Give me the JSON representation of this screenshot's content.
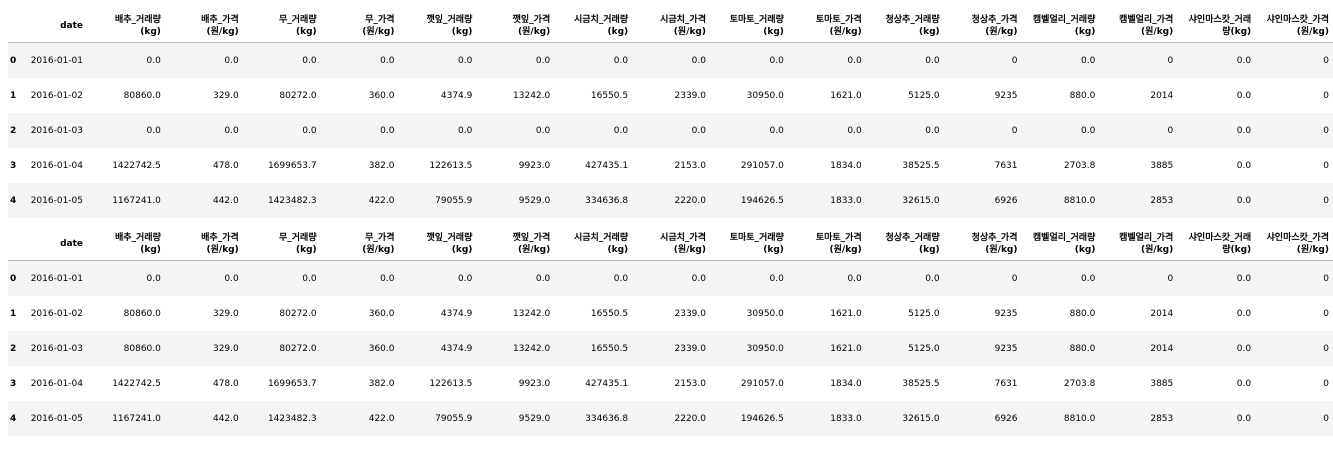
{
  "columns": {
    "date": "date",
    "headers": [
      "배추_거래량\n(kg)",
      "배추_가격\n(원/kg)",
      "무_거래량\n(kg)",
      "무_가격\n(원/kg)",
      "깻잎_거래량\n(kg)",
      "깻잎_가격\n(원/kg)",
      "시금치_거래량\n(kg)",
      "시금치_가격\n(원/kg)",
      "토마토_거래량\n(kg)",
      "토마토_가격\n(원/kg)",
      "청상추_거래량\n(kg)",
      "청상추_가격\n(원/kg)",
      "캠벨얼리_거래량\n(kg)",
      "캠벨얼리_가격\n(원/kg)",
      "샤인마스캇_거래\n량(kg)",
      "샤인마스캇_가격\n(원/kg)"
    ]
  },
  "tables": [
    {
      "rows": [
        {
          "index": "0",
          "date": "2016-01-01",
          "values": [
            "0.0",
            "0.0",
            "0.0",
            "0.0",
            "0.0",
            "0.0",
            "0.0",
            "0.0",
            "0.0",
            "0.0",
            "0.0",
            "0",
            "0.0",
            "0",
            "0.0",
            "0"
          ]
        },
        {
          "index": "1",
          "date": "2016-01-02",
          "values": [
            "80860.0",
            "329.0",
            "80272.0",
            "360.0",
            "4374.9",
            "13242.0",
            "16550.5",
            "2339.0",
            "30950.0",
            "1621.0",
            "5125.0",
            "9235",
            "880.0",
            "2014",
            "0.0",
            "0"
          ]
        },
        {
          "index": "2",
          "date": "2016-01-03",
          "values": [
            "0.0",
            "0.0",
            "0.0",
            "0.0",
            "0.0",
            "0.0",
            "0.0",
            "0.0",
            "0.0",
            "0.0",
            "0.0",
            "0",
            "0.0",
            "0",
            "0.0",
            "0"
          ]
        },
        {
          "index": "3",
          "date": "2016-01-04",
          "values": [
            "1422742.5",
            "478.0",
            "1699653.7",
            "382.0",
            "122613.5",
            "9923.0",
            "427435.1",
            "2153.0",
            "291057.0",
            "1834.0",
            "38525.5",
            "7631",
            "2703.8",
            "3885",
            "0.0",
            "0"
          ]
        },
        {
          "index": "4",
          "date": "2016-01-05",
          "values": [
            "1167241.0",
            "442.0",
            "1423482.3",
            "422.0",
            "79055.9",
            "9529.0",
            "334636.8",
            "2220.0",
            "194626.5",
            "1833.0",
            "32615.0",
            "6926",
            "8810.0",
            "2853",
            "0.0",
            "0"
          ]
        }
      ]
    },
    {
      "rows": [
        {
          "index": "0",
          "date": "2016-01-01",
          "values": [
            "0.0",
            "0.0",
            "0.0",
            "0.0",
            "0.0",
            "0.0",
            "0.0",
            "0.0",
            "0.0",
            "0.0",
            "0.0",
            "0",
            "0.0",
            "0",
            "0.0",
            "0"
          ]
        },
        {
          "index": "1",
          "date": "2016-01-02",
          "values": [
            "80860.0",
            "329.0",
            "80272.0",
            "360.0",
            "4374.9",
            "13242.0",
            "16550.5",
            "2339.0",
            "30950.0",
            "1621.0",
            "5125.0",
            "9235",
            "880.0",
            "2014",
            "0.0",
            "0"
          ]
        },
        {
          "index": "2",
          "date": "2016-01-03",
          "values": [
            "80860.0",
            "329.0",
            "80272.0",
            "360.0",
            "4374.9",
            "13242.0",
            "16550.5",
            "2339.0",
            "30950.0",
            "1621.0",
            "5125.0",
            "9235",
            "880.0",
            "2014",
            "0.0",
            "0"
          ]
        },
        {
          "index": "3",
          "date": "2016-01-04",
          "values": [
            "1422742.5",
            "478.0",
            "1699653.7",
            "382.0",
            "122613.5",
            "9923.0",
            "427435.1",
            "2153.0",
            "291057.0",
            "1834.0",
            "38525.5",
            "7631",
            "2703.8",
            "3885",
            "0.0",
            "0"
          ]
        },
        {
          "index": "4",
          "date": "2016-01-05",
          "values": [
            "1167241.0",
            "442.0",
            "1423482.3",
            "422.0",
            "79055.9",
            "9529.0",
            "334636.8",
            "2220.0",
            "194626.5",
            "1833.0",
            "32615.0",
            "6926",
            "8810.0",
            "2853",
            "0.0",
            "0"
          ]
        }
      ]
    }
  ]
}
